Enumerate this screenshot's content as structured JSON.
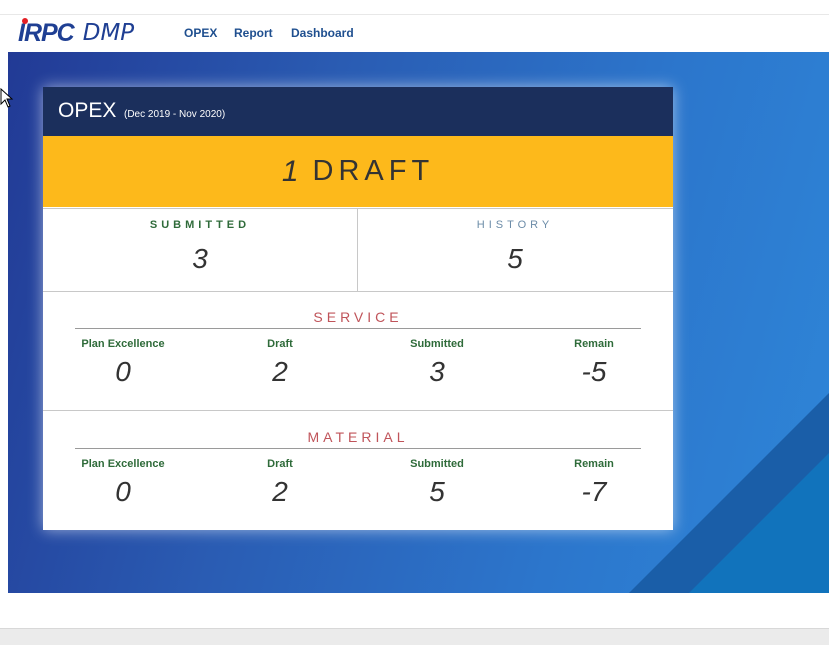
{
  "nav": {
    "logo_brand": "IRPC",
    "logo_app": "DMP",
    "links": [
      "OPEX",
      "Report",
      "Dashboard"
    ]
  },
  "card": {
    "title": "OPEX",
    "period": "(Dec 2019 - Nov 2020)",
    "draft": {
      "count": "1",
      "label": "DRAFT"
    },
    "submitted": {
      "label": "SUBMITTED",
      "value": "3"
    },
    "history": {
      "label": "HISTORY",
      "value": "5"
    },
    "sections": [
      {
        "title": "SERVICE",
        "columns": [
          {
            "header": "Plan Excellence",
            "value": "0"
          },
          {
            "header": "Draft",
            "value": "2"
          },
          {
            "header": "Submitted",
            "value": "3"
          },
          {
            "header": "Remain",
            "value": "-5"
          }
        ]
      },
      {
        "title": "MATERIAL",
        "columns": [
          {
            "header": "Plan Excellence",
            "value": "0"
          },
          {
            "header": "Draft",
            "value": "2"
          },
          {
            "header": "Submitted",
            "value": "5"
          },
          {
            "header": "Remain",
            "value": "-7"
          }
        ]
      }
    ]
  },
  "colors": {
    "brand_blue": "#1f3f93",
    "header_navy": "#1b2f5c",
    "draft_yellow": "#fdb91b",
    "label_green": "#2f6b3a",
    "section_red": "#c0545a",
    "history_blue": "#6c8ca8"
  },
  "icons": [
    "mouse-cursor-icon"
  ]
}
